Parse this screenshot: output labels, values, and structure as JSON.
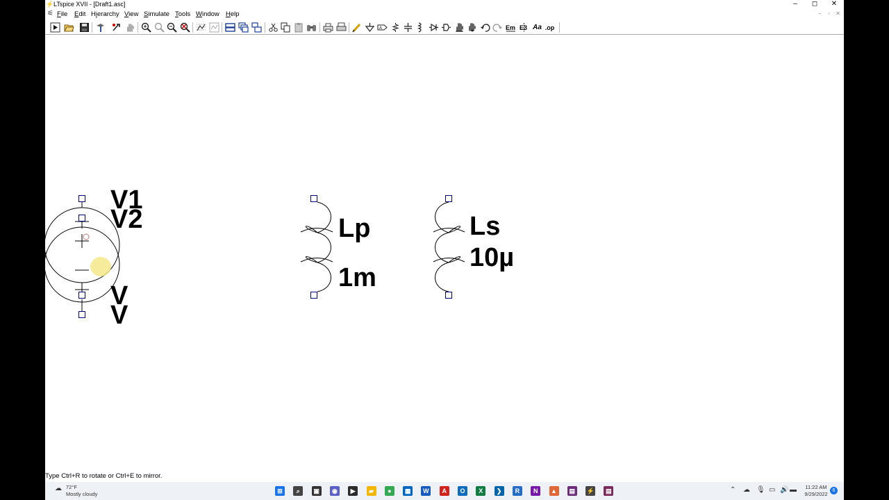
{
  "window": {
    "title": "LTspice XVII - [Draft1.asc]",
    "app_icon": "ltspice-icon",
    "controls": {
      "minimize": "–",
      "maximize": "◻",
      "close": "✕"
    }
  },
  "menubar": {
    "doc_icon": "schematic-doc-icon",
    "items": [
      {
        "key": "F",
        "rest": "ile"
      },
      {
        "key": "E",
        "rest": "dit"
      },
      {
        "key": "",
        "rest": "Hierarchy",
        "key_inner": "i"
      },
      {
        "key": "V",
        "rest": "iew"
      },
      {
        "key": "S",
        "rest": "imulate"
      },
      {
        "key": "T",
        "rest": "ools"
      },
      {
        "key": "W",
        "rest": "indow"
      },
      {
        "key": "H",
        "rest": "elp"
      }
    ],
    "mdi": {
      "minimize": "–",
      "restore": "▫",
      "close": "✕"
    }
  },
  "toolbar": {
    "buttons": [
      "run-icon",
      "open-icon",
      "save-icon",
      "control-panel-icon",
      "halt-icon",
      "pan-icon",
      "zoom-in-icon",
      "zoom-out-icon",
      "zoom-full-icon",
      "zoom-cancel-icon",
      "autorange-icon",
      "waveform-icon",
      "tile-horizontal-icon",
      "cascade-icon",
      "tile-vertical-icon",
      "cut-icon",
      "copy-icon",
      "paste-icon",
      "find-icon",
      "print-icon",
      "print-setup-icon",
      "draw-wire-icon",
      "ground-icon",
      "label-net-icon",
      "resistor-icon",
      "capacitor-icon",
      "inductor-icon",
      "diode-icon",
      "component-icon",
      "move-icon",
      "drag-icon",
      "undo-icon",
      "redo-icon",
      "rotate-icon",
      "mirror-icon",
      "text-icon",
      "spice-directive-icon"
    ],
    "text_labels": {
      "text": "Aa",
      "directive": ".op"
    }
  },
  "schematic": {
    "voltage_sources": {
      "labels": [
        "V1",
        "V2"
      ],
      "values": [
        "V",
        "V"
      ]
    },
    "inductor_primary": {
      "name": "Lp",
      "value": "1m"
    },
    "inductor_secondary": {
      "name": "Ls",
      "value": "10µ"
    }
  },
  "status": {
    "text": "Type Ctrl+R to rotate or Ctrl+E to mirror."
  },
  "taskbar": {
    "weather": {
      "temp": "72°F",
      "condition": "Mostly cloudy"
    },
    "clock": {
      "time": "11:22 AM",
      "date": "9/29/2022"
    },
    "notification_count": "6",
    "apps": [
      {
        "name": "start-icon",
        "label": "⊞",
        "color": "#1a73e8"
      },
      {
        "name": "search-icon",
        "label": "⌕",
        "color": "#444"
      },
      {
        "name": "task-view-icon",
        "label": "▣",
        "color": "#333"
      },
      {
        "name": "chat-icon",
        "label": "◉",
        "color": "#5b5fc7"
      },
      {
        "name": "terminal-icon",
        "label": "▶",
        "color": "#2b2b2b"
      },
      {
        "name": "file-explorer-icon",
        "label": "▰",
        "color": "#f2b705"
      },
      {
        "name": "chrome-icon",
        "label": "●",
        "color": "#34a853"
      },
      {
        "name": "store-icon",
        "label": "▦",
        "color": "#0067c0"
      },
      {
        "name": "word-icon",
        "label": "W",
        "color": "#185abd"
      },
      {
        "name": "acrobat-icon",
        "label": "A",
        "color": "#d3221c"
      },
      {
        "name": "outlook-icon",
        "label": "O",
        "color": "#0f6cbd"
      },
      {
        "name": "excel-icon",
        "label": "X",
        "color": "#107c41"
      },
      {
        "name": "vscode-icon",
        "label": "❯",
        "color": "#0065a9"
      },
      {
        "name": "r-icon",
        "label": "R",
        "color": "#276dc3"
      },
      {
        "name": "onenote-icon",
        "label": "N",
        "color": "#7719aa"
      },
      {
        "name": "matlab-icon",
        "label": "▲",
        "color": "#e16737"
      },
      {
        "name": "app-purple-icon",
        "label": "▤",
        "color": "#6b2c7a"
      },
      {
        "name": "ltspice-task-icon",
        "label": "⚡",
        "color": "#444"
      },
      {
        "name": "app-maroon-icon",
        "label": "▤",
        "color": "#7a2c5a"
      }
    ]
  },
  "colors": {
    "wire": "#000000",
    "pin_box": "#000080",
    "cursor_highlight": "#f5e88a",
    "accent": "#0067c0"
  }
}
